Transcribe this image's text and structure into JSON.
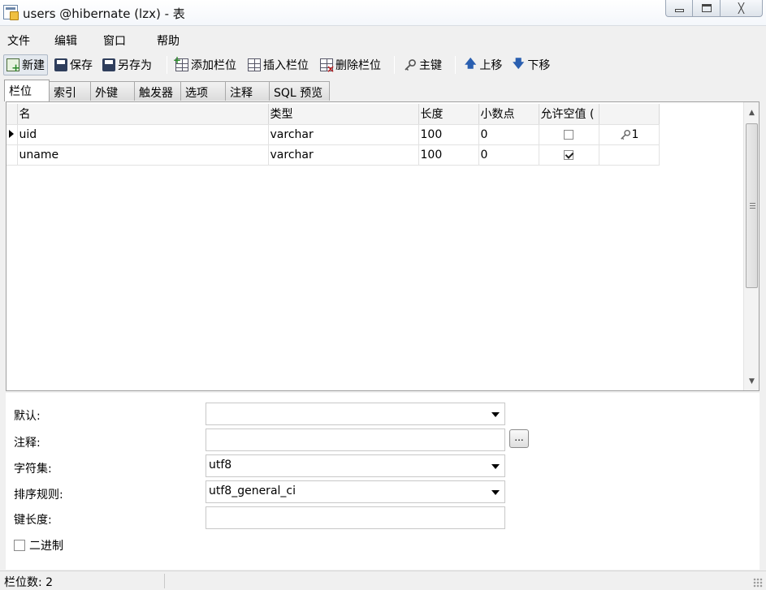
{
  "window": {
    "title": "users @hibernate (lzx) - 表",
    "minimize_label": "",
    "maximize_label": "",
    "close_label": "╳"
  },
  "menu": [
    "文件",
    "编辑",
    "窗口",
    "帮助"
  ],
  "toolbar": {
    "new": "新建",
    "save": "保存",
    "save_as": "另存为",
    "add_field": "添加栏位",
    "insert_field": "插入栏位",
    "delete_field": "删除栏位",
    "primary_key": "主键",
    "move_up": "上移",
    "move_down": "下移"
  },
  "tabs": [
    "栏位",
    "索引",
    "外键",
    "触发器",
    "选项",
    "注释",
    "SQL 预览"
  ],
  "grid": {
    "columns": [
      "名",
      "类型",
      "长度",
      "小数点",
      "允许空值 (",
      ""
    ],
    "rows": [
      {
        "name": "uid",
        "type": "varchar",
        "length": "100",
        "decimals": "0",
        "allow_null": false,
        "key": "1",
        "selected": true
      },
      {
        "name": "uname",
        "type": "varchar",
        "length": "100",
        "decimals": "0",
        "allow_null": true,
        "key": "",
        "selected": false
      }
    ]
  },
  "properties": {
    "default_label": "默认:",
    "default_value": "",
    "comment_label": "注释:",
    "comment_value": "",
    "comment_button": "...",
    "charset_label": "字符集:",
    "charset_value": "utf8",
    "collation_label": "排序规则:",
    "collation_value": "utf8_general_ci",
    "key_length_label": "键长度:",
    "key_length_value": "",
    "binary_label": "二进制",
    "binary_checked": false
  },
  "status": {
    "field_count": "栏位数: 2"
  },
  "icons": {
    "key": "key-icon",
    "up": "arrow-up-icon",
    "down": "arrow-down-icon"
  }
}
